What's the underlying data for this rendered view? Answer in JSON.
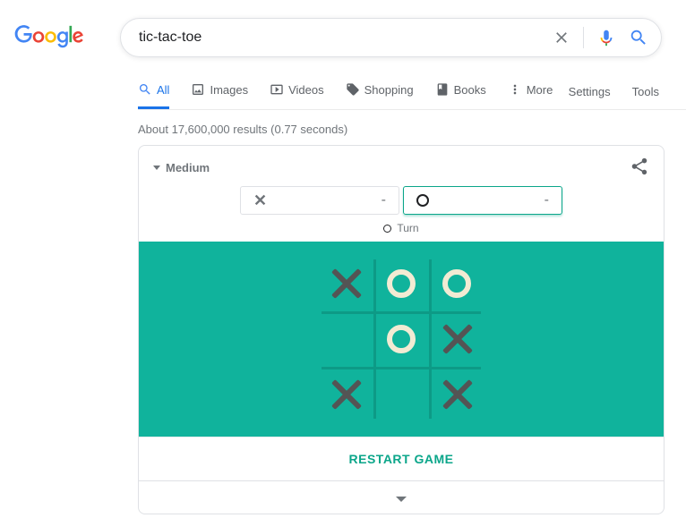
{
  "search": {
    "query": "tic-tac-toe"
  },
  "tabs": {
    "all": "All",
    "images": "Images",
    "videos": "Videos",
    "shopping": "Shopping",
    "books": "Books",
    "more": "More"
  },
  "tools": {
    "settings": "Settings",
    "tools": "Tools"
  },
  "stats": "About 17,600,000 results (0.77 seconds)",
  "game": {
    "difficulty": "Medium",
    "scores": {
      "x": "-",
      "o": "-"
    },
    "turn_label": "Turn",
    "current_turn": "O",
    "board": [
      [
        "X",
        "O",
        "O"
      ],
      [
        "",
        "O",
        "X"
      ],
      [
        "X",
        "",
        "X"
      ]
    ],
    "restart": "RESTART GAME"
  }
}
